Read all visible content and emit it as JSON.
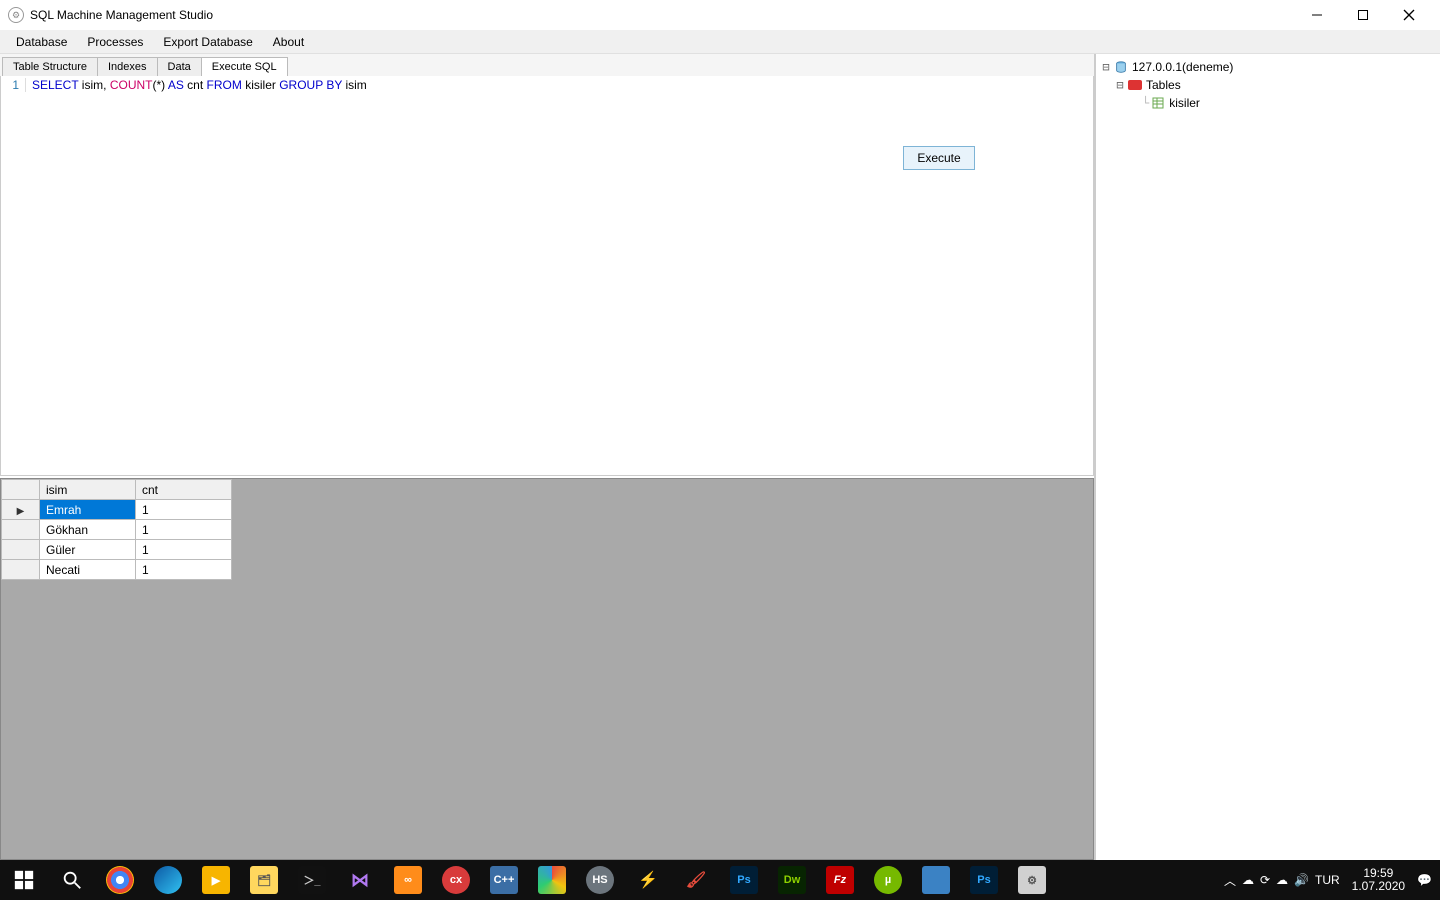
{
  "titlebar": {
    "title": "SQL Machine Management Studio"
  },
  "menu": {
    "database": "Database",
    "processes": "Processes",
    "export": "Export Database",
    "about": "About"
  },
  "tabs": {
    "structure": "Table Structure",
    "indexes": "Indexes",
    "data": "Data",
    "execute": "Execute SQL"
  },
  "editor": {
    "line_number": "1",
    "sql_tokens": {
      "select": "SELECT",
      "col1": " isim, ",
      "count": "COUNT",
      "paren": "(*) ",
      "as": "AS",
      "alias": " cnt ",
      "from": "FROM",
      "table": " kisiler ",
      "group": "GROUP",
      "by": " BY",
      "col2": " isim"
    },
    "execute_label": "Execute"
  },
  "results": {
    "columns": [
      "isim",
      "cnt"
    ],
    "rows": [
      {
        "isim": "Emrah",
        "cnt": "1",
        "selected": true
      },
      {
        "isim": "Gökhan",
        "cnt": "1",
        "selected": false
      },
      {
        "isim": "Güler",
        "cnt": "1",
        "selected": false
      },
      {
        "isim": "Necati",
        "cnt": "1",
        "selected": false
      }
    ]
  },
  "tree": {
    "server": "127.0.0.1(deneme)",
    "tables_label": "Tables",
    "table_name": "kisiler"
  },
  "tray": {
    "lang": "TUR",
    "time": "19:59",
    "date": "1.07.2020"
  }
}
